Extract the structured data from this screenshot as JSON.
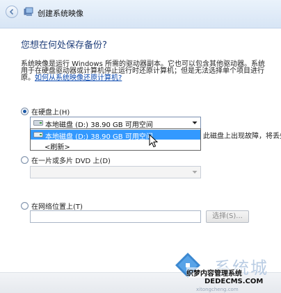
{
  "window": {
    "title": "创建系统映像"
  },
  "heading": "您想在何处保存备份?",
  "description": {
    "line1": "系统映像是运行 Windows 所需的驱动器副本。它也可以包含其他驱动器。系统",
    "line2": "用于在硬盘驱动器或计算机停止运行时还原计算机；但是无法选择单个项目进行",
    "line3_prefix": "原。",
    "link": "如何从系统映像还原计算机?"
  },
  "options": {
    "hard_disk": {
      "label": "在硬盘上(H)",
      "selected_value": "本地磁盘 (D:)  38.90 GB 可用空间",
      "dropdown_items": [
        "本地磁盘 (D:)  38.90 GB 可用空间",
        "<刷新>"
      ],
      "trailing_text": "此磁盘上出现故障，将丢失"
    },
    "dvd": {
      "label": "在一片或多片 DVD 上(D)"
    },
    "network": {
      "label": "在网络位置上(T)",
      "select_button": "选择(S)..."
    }
  },
  "watermark": {
    "name": "系统城",
    "subtitle1": "织梦内容管理系统",
    "subtitle2": "DEDECMS.COM",
    "subtitle3": "xitongcheng.com"
  },
  "colors": {
    "selection": "#3399ff",
    "heading": "#1f3e7a",
    "link": "#0645ad"
  }
}
